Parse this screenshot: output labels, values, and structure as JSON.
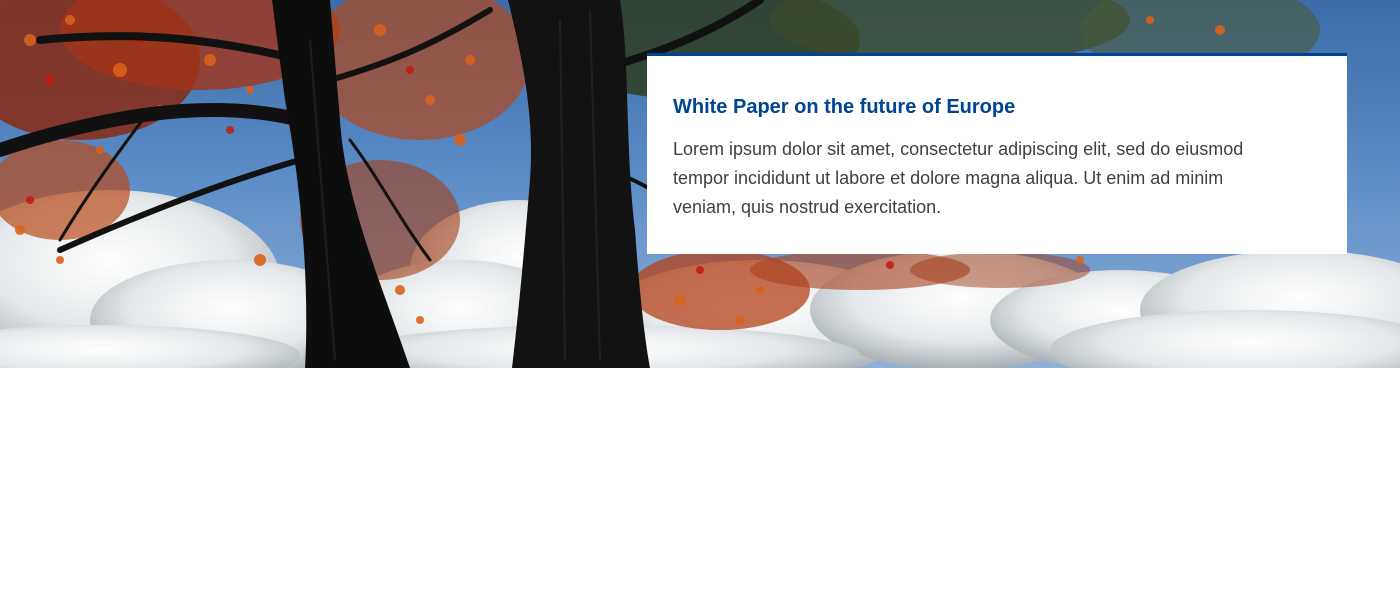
{
  "banner": {
    "title": "White Paper on the future of Europe",
    "description": "Lorem ipsum dolor sit amet, consectetur adipiscing elit, sed do eiusmod tempor incididunt ut labore et dolore magna aliqua. Ut enim ad minim veniam, quis nostrud exercitation.",
    "accent_color": "#004494",
    "text_color": "#404040"
  },
  "hero": {
    "image": "autumn-trees-against-cloudy-sky-photo"
  }
}
